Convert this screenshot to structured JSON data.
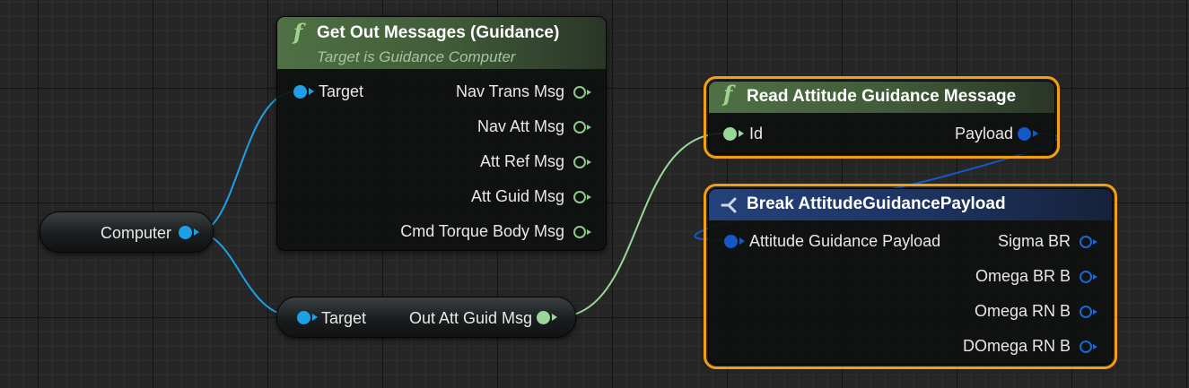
{
  "colors": {
    "function_header": "#4f7145",
    "struct_header": "#24427a",
    "selection": "#f0a010",
    "object_pin": "#1ea0e6",
    "struct_pin": "#9ad89a",
    "payload_pin": "#1558c8"
  },
  "nodes": {
    "get_out_messages": {
      "icon": "function-icon",
      "title": "Get Out Messages (Guidance)",
      "subtitle": "Target is Guidance Computer",
      "inputs": [
        {
          "label": "Target"
        }
      ],
      "outputs": [
        {
          "label": "Nav Trans Msg"
        },
        {
          "label": "Nav Att Msg"
        },
        {
          "label": "Att Ref Msg"
        },
        {
          "label": "Att Guid Msg"
        },
        {
          "label": "Cmd Torque Body Msg"
        }
      ]
    },
    "computer_var": {
      "label": "Computer"
    },
    "out_att_guid_getter": {
      "input_label": "Target",
      "output_label": "Out Att Guid Msg"
    },
    "read_attitude_msg": {
      "icon": "function-icon",
      "title": "Read Attitude Guidance Message",
      "input_label": "Id",
      "output_label": "Payload"
    },
    "break_payload": {
      "icon": "break-struct-icon",
      "title": "Break AttitudeGuidancePayload",
      "input_label": "Attitude Guidance Payload",
      "outputs": [
        {
          "label": "Sigma BR"
        },
        {
          "label": "Omega BR B"
        },
        {
          "label": "Omega RN B"
        },
        {
          "label": "DOmega RN B"
        }
      ]
    }
  }
}
